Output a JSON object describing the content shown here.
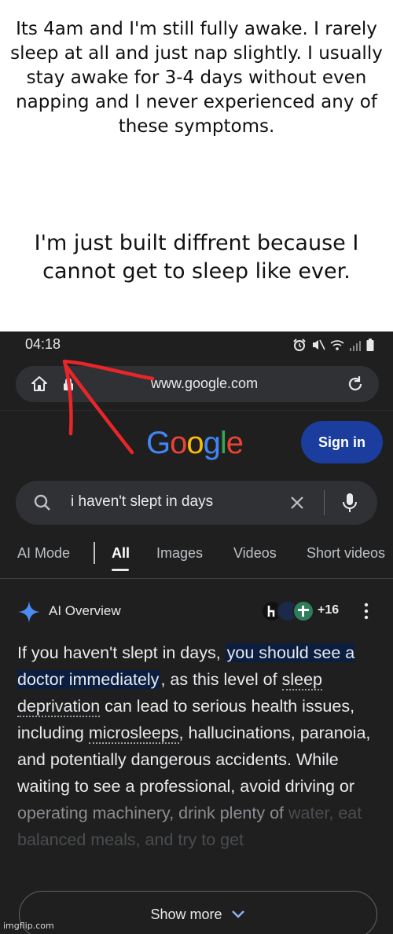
{
  "caption": {
    "line1": "Its 4am and I'm still fully awake. I rarely sleep at all and just nap slightly. I usually stay awake for 3-4 days without even napping and I never experienced any of these symptoms.",
    "line2": "I'm just built diffrent because I cannot get to sleep like ever."
  },
  "status_bar": {
    "time": "04:18"
  },
  "browser": {
    "url": "www.google.com"
  },
  "google": {
    "logo": "Google",
    "sign_in": "Sign in"
  },
  "search": {
    "query": "i haven't slept in days"
  },
  "tabs": [
    "AI Mode",
    "All",
    "Images",
    "Videos",
    "Short videos"
  ],
  "ai_overview": {
    "title": "AI Overview",
    "sources_more": "+16",
    "text": {
      "p1": "If you haven't slept in days, ",
      "highlight": "you should see a doctor immediately",
      "p2": ", as this level of ",
      "link1": "sleep deprivation",
      "p3": " can lead to serious health issues, including ",
      "link2": "microsleeps",
      "p4": ", hallucinations, paranoia, and potentially dangerous accidents. While waiting to see a professional, avoid driving or ",
      "p5": "operating machinery, drink plenty of ",
      "p6": "water, eat balanced meals, and try to get"
    },
    "show_more": "Show more"
  },
  "watermark": "imgflip.com",
  "colors": {
    "google_blue": "#4285F4",
    "google_red": "#EA4335",
    "google_yellow": "#FBBC05",
    "google_green": "#34A853",
    "annotation_red": "#e8262a",
    "sign_in_bg": "#1a3d9e"
  }
}
